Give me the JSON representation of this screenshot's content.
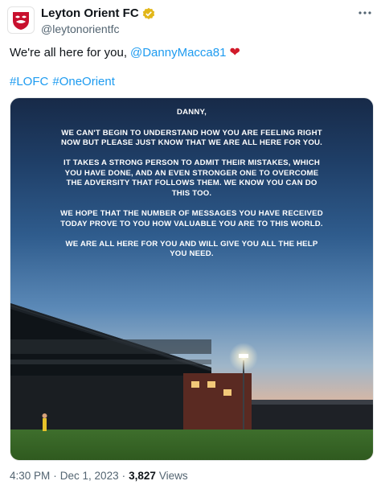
{
  "account": {
    "display_name": "Leyton Orient FC",
    "handle": "@leytonorientfc",
    "verified_icon": "verified-badge-icon",
    "brand_color": "#c8102e"
  },
  "tweet": {
    "text_prefix": "We're all here for you,",
    "mention": "@DannyMacca81",
    "emoji": "❤",
    "hashtags": [
      "#LOFC",
      "#OneOrient"
    ],
    "link_color": "#1d9bf0"
  },
  "image": {
    "letter": [
      "DANNY,",
      "WE CAN'T BEGIN TO UNDERSTAND HOW YOU ARE FEELING RIGHT NOW BUT PLEASE JUST KNOW THAT WE ARE ALL HERE FOR YOU.",
      "IT TAKES A STRONG PERSON TO ADMIT THEIR MISTAKES, WHICH YOU HAVE DONE, AND AN EVEN STRONGER ONE TO OVERCOME THE ADVERSITY THAT FOLLOWS THEM. WE KNOW YOU CAN DO THIS TOO.",
      "WE HOPE THAT THE NUMBER OF MESSAGES YOU HAVE RECEIVED TODAY PROVE TO YOU HOW VALUABLE YOU ARE TO THIS WORLD.",
      "WE ARE ALL HERE FOR YOU AND WILL GIVE YOU ALL THE HELP YOU NEED."
    ]
  },
  "meta": {
    "time": "4:30 PM",
    "separator": "·",
    "date": "Dec 1, 2023",
    "views_count": "3,827",
    "views_label": "Views"
  }
}
